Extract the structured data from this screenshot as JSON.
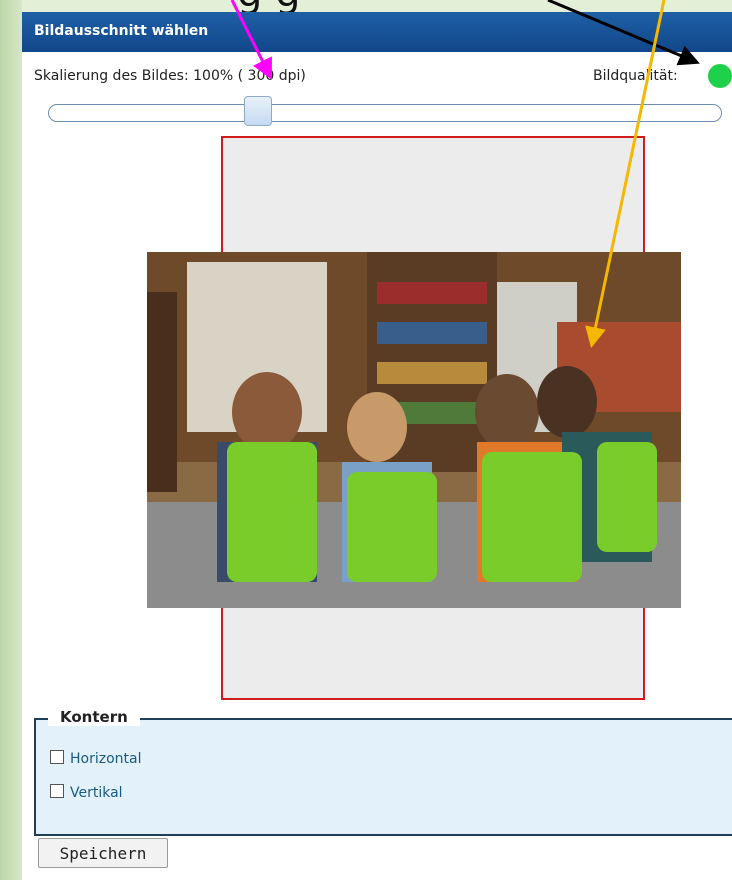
{
  "dialog": {
    "title": "Bildausschnitt wählen",
    "scale_label": "Skalierung des Bildes: 100% ( 300 dpi)",
    "quality_label": "Bildqualität:",
    "quality_color": "#1fd04a",
    "slider_level_percent": 30
  },
  "kontern": {
    "legend": "Kontern",
    "options": [
      {
        "label": "Horizontal",
        "checked": false
      },
      {
        "label": "Vertikal",
        "checked": false
      }
    ]
  },
  "save_label": "Speichern",
  "annotation": {
    "top_text": "g           g",
    "arrow_colors": [
      "#ff00ff",
      "#000000",
      "#f5b800"
    ]
  }
}
